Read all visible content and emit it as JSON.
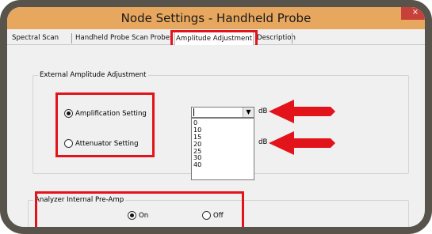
{
  "window": {
    "title": "Node Settings - Handheld Probe",
    "close_label": "×"
  },
  "tabs": [
    {
      "label": "Spectral Scan"
    },
    {
      "label": "Handheld Probe Scan Probes"
    },
    {
      "label": "Amplitude Adjustment",
      "active": true
    },
    {
      "label": "Description"
    }
  ],
  "external_group": {
    "label": "External Amplitude Adjustment",
    "amplification": {
      "label": "Amplification Setting",
      "checked": true
    },
    "attenuator": {
      "label": "Attenuator Setting",
      "checked": false
    },
    "amp_combo_value": "",
    "unit_1": "dB",
    "unit_2": "dB",
    "dropdown_options": [
      "0",
      "10",
      "15",
      "20",
      "25",
      "30",
      "40"
    ]
  },
  "preamp_group": {
    "label": "Analyzer Internal Pre-Amp",
    "on": {
      "label": "On",
      "checked": true
    },
    "off": {
      "label": "Off",
      "checked": false
    }
  },
  "colors": {
    "highlight": "#e3131b",
    "titlebar": "#e8a75e",
    "frame": "#58544b",
    "close_button": "#c7413a"
  }
}
